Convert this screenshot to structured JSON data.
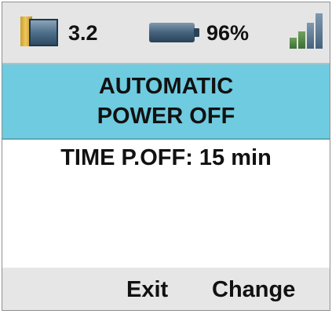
{
  "status_bar": {
    "memory_icon": "memory-card-icon",
    "memory_value": "3.2",
    "battery_icon": "battery-icon",
    "battery_level": "96%",
    "signal_icon": "signal-strength-icon"
  },
  "title": {
    "line1": "AUTOMATIC",
    "line2": "POWER OFF"
  },
  "setting": {
    "text": "TIME P.OFF: 15 min"
  },
  "softkeys": {
    "exit_label": "Exit",
    "change_label": "Change"
  },
  "colors": {
    "title_banner": "#6fcbdf",
    "status_bar": "#e5e5e5",
    "softkey_bar": "#e6e6e6"
  }
}
